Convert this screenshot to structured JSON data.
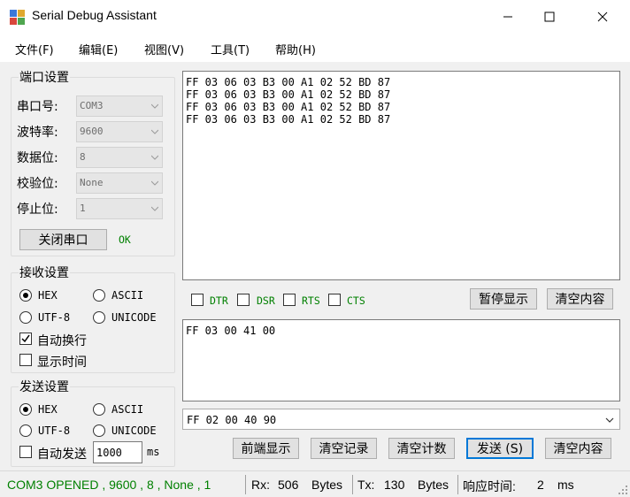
{
  "window": {
    "title": "Serial Debug Assistant"
  },
  "menu": [
    "文件(F)",
    "编辑(E)",
    "视图(V)",
    "工具(T)",
    "帮助(H)"
  ],
  "port": {
    "group_title": "端口设置",
    "port_label": "串口号:",
    "port_value": "COM3",
    "baud_label": "波特率:",
    "baud_value": "9600",
    "data_label": "数据位:",
    "data_value": "8",
    "parity_label": "校验位:",
    "parity_value": "None",
    "stop_label": "停止位:",
    "stop_value": "1",
    "close_button": "关闭串口",
    "status": "OK"
  },
  "receive": {
    "group_title": "接收设置",
    "hex": "HEX",
    "ascii": "ASCII",
    "utf8": "UTF-8",
    "unicode": "UNICODE",
    "auto_wrap": "自动换行",
    "show_time": "显示时间",
    "selected": "HEX",
    "auto_wrap_checked": true,
    "show_time_checked": false
  },
  "send": {
    "group_title": "发送设置",
    "hex": "HEX",
    "ascii": "ASCII",
    "utf8": "UTF-8",
    "unicode": "UNICODE",
    "auto_send": "自动发送",
    "interval": "1000",
    "unit": "ms",
    "selected": "HEX",
    "auto_send_checked": false
  },
  "recv_lines": [
    "FF 03 06 03 B3 00 A1 02 52 BD 87",
    "FF 03 06 03 B3 00 A1 02 52 BD 87",
    "FF 03 06 03 B3 00 A1 02 52 BD 87",
    "FF 03 06 03 B3 00 A1 02 52 BD 87"
  ],
  "signals": [
    "DTR",
    "DSR",
    "RTS",
    "CTS"
  ],
  "pause_button": "暂停显示",
  "clear_content_button": "清空内容",
  "send_text": "FF 03 00 41 00",
  "history_value": "FF 02 00 40 90",
  "actions": {
    "prev_display": "前端显示",
    "clear_record": "清空记录",
    "clear_count": "清空计数",
    "send": "发送 (S)",
    "clear_content": "清空内容"
  },
  "statusbar": {
    "conn": "COM3 OPENED , 9600 , 8 , None , 1",
    "rx_label": "Rx:",
    "rx_value": "506",
    "rx_unit": "Bytes",
    "tx_label": "Tx:",
    "tx_value": "130",
    "tx_unit": "Bytes",
    "resp_label": "响应时间:",
    "resp_value": "2",
    "resp_unit": "ms"
  },
  "colors": {
    "accent": "#0078d7",
    "ok_green": "#008000",
    "status_green": "#008000"
  }
}
